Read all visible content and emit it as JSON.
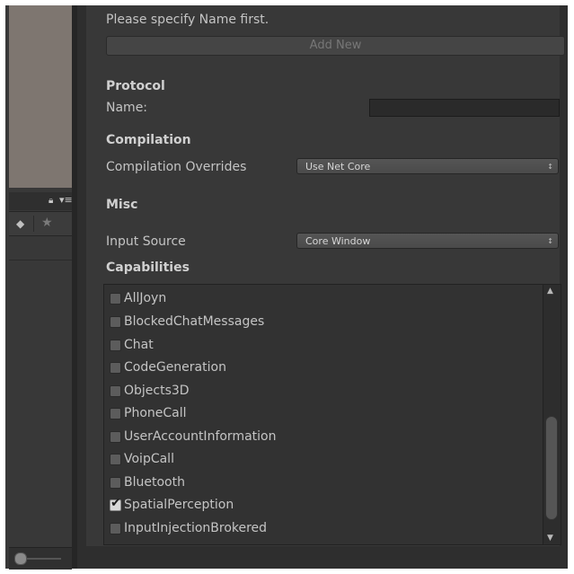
{
  "left_panel": {
    "lock_icon": "lock-icon",
    "menu_icon": "menu-icon",
    "tag_icon": "tag-icon",
    "star_icon": "star-icon",
    "zoom_slider_value": 0
  },
  "inspector": {
    "notice": "Please specify Name first.",
    "add_new_label": "Add New",
    "protocol": {
      "header": "Protocol",
      "name_label": "Name:",
      "name_value": ""
    },
    "compilation": {
      "header": "Compilation",
      "overrides_label": "Compilation Overrides",
      "overrides_value": "Use Net Core"
    },
    "misc": {
      "header": "Misc",
      "input_source_label": "Input Source",
      "input_source_value": "Core Window"
    },
    "capabilities": {
      "header": "Capabilities",
      "items": [
        {
          "label": "AllJoyn",
          "checked": false
        },
        {
          "label": "BlockedChatMessages",
          "checked": false
        },
        {
          "label": "Chat",
          "checked": false
        },
        {
          "label": "CodeGeneration",
          "checked": false
        },
        {
          "label": "Objects3D",
          "checked": false
        },
        {
          "label": "PhoneCall",
          "checked": false
        },
        {
          "label": "UserAccountInformation",
          "checked": false
        },
        {
          "label": "VoipCall",
          "checked": false
        },
        {
          "label": "Bluetooth",
          "checked": false
        },
        {
          "label": "SpatialPerception",
          "checked": true
        },
        {
          "label": "InputInjectionBrokered",
          "checked": false
        }
      ]
    }
  },
  "colors": {
    "panel_bg": "#383838",
    "text": "#c4c4c4",
    "preview_bg": "#7e7670"
  }
}
